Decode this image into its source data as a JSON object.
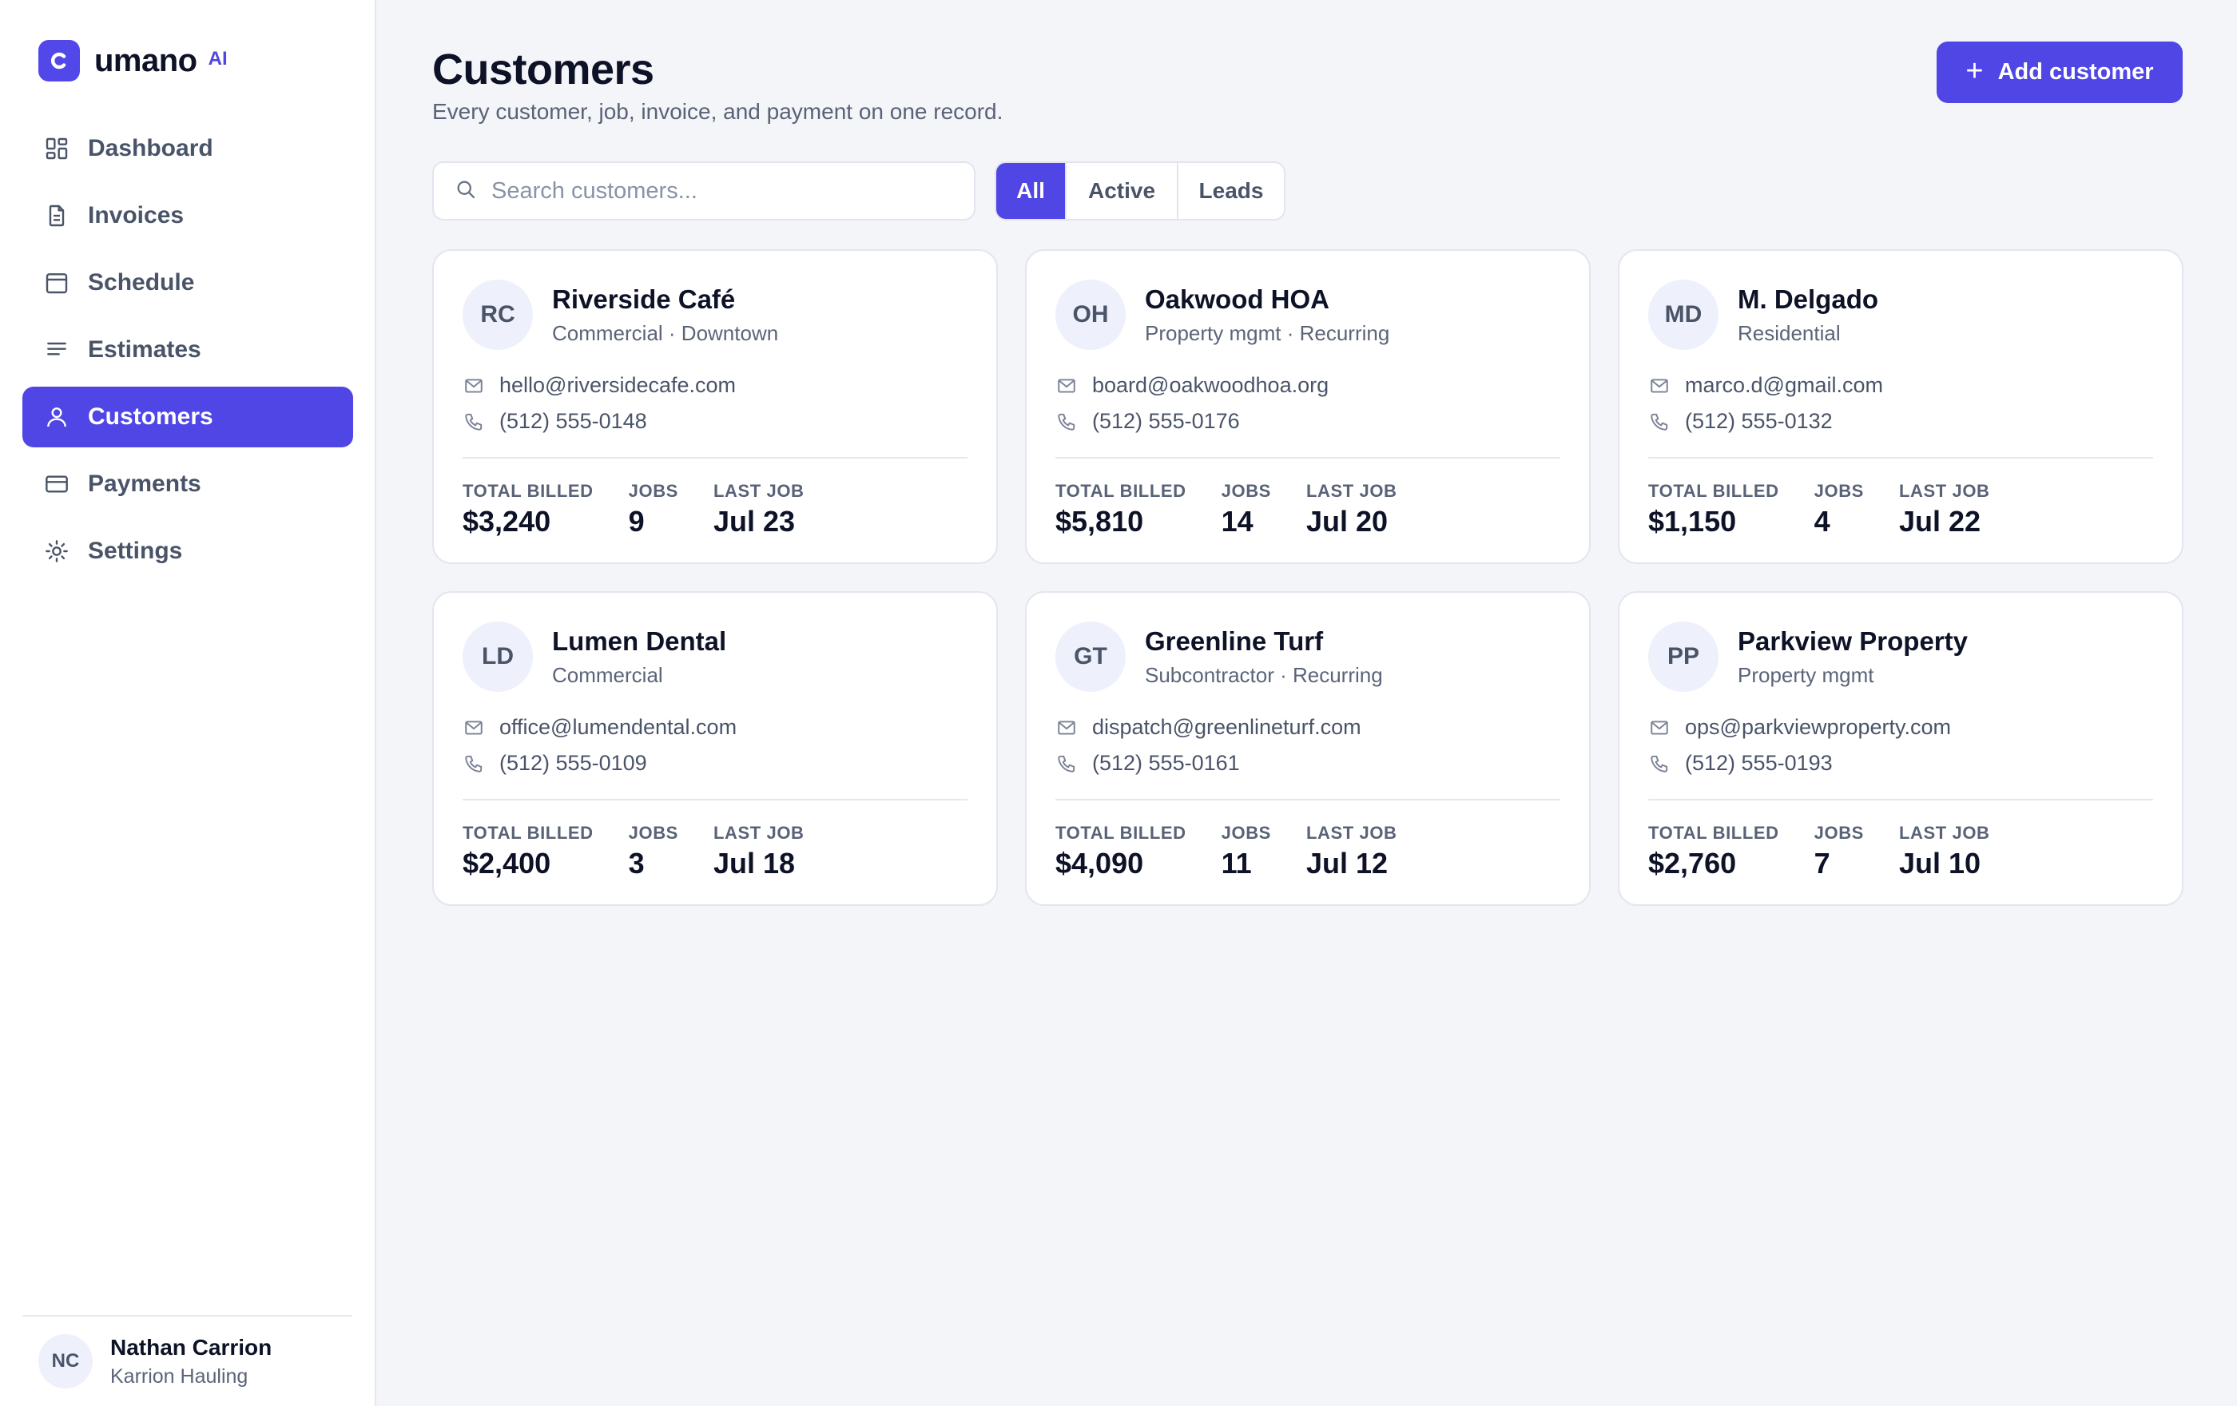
{
  "brand": {
    "name": "umano",
    "tag": "AI",
    "accent": "#4f46e5"
  },
  "nav": {
    "items": [
      {
        "label": "Dashboard",
        "icon": "grid-icon",
        "active": false
      },
      {
        "label": "Invoices",
        "icon": "document-icon",
        "active": false
      },
      {
        "label": "Schedule",
        "icon": "calendar-icon",
        "active": false
      },
      {
        "label": "Estimates",
        "icon": "list-icon",
        "active": false
      },
      {
        "label": "Customers",
        "icon": "user-icon",
        "active": true
      },
      {
        "label": "Payments",
        "icon": "credit-card-icon",
        "active": false
      },
      {
        "label": "Settings",
        "icon": "gear-icon",
        "active": false
      }
    ]
  },
  "user": {
    "initials": "NC",
    "name": "Nathan Carrion",
    "org": "Karrion Hauling"
  },
  "header": {
    "title": "Customers",
    "subtitle": "Every customer, job, invoice, and payment on one record.",
    "add_button": "Add customer"
  },
  "search": {
    "placeholder": "Search customers...",
    "value": ""
  },
  "filters": {
    "tabs": [
      "All",
      "Active",
      "Leads"
    ],
    "selected": "All"
  },
  "stat_labels": {
    "billed": "TOTAL BILLED",
    "jobs": "JOBS",
    "last": "LAST JOB"
  },
  "customers": [
    {
      "initials": "RC",
      "name": "Riverside Café",
      "type": "Commercial · Downtown",
      "email": "hello@riversidecafe.com",
      "phone": "(512) 555-0148",
      "billed": "$3,240",
      "jobs": "9",
      "last_job": "Jul 23"
    },
    {
      "initials": "OH",
      "name": "Oakwood HOA",
      "type": "Property mgmt · Recurring",
      "email": "board@oakwoodhoa.org",
      "phone": "(512) 555-0176",
      "billed": "$5,810",
      "jobs": "14",
      "last_job": "Jul 20"
    },
    {
      "initials": "MD",
      "name": "M. Delgado",
      "type": "Residential",
      "email": "marco.d@gmail.com",
      "phone": "(512) 555-0132",
      "billed": "$1,150",
      "jobs": "4",
      "last_job": "Jul 22"
    },
    {
      "initials": "LD",
      "name": "Lumen Dental",
      "type": "Commercial",
      "email": "office@lumendental.com",
      "phone": "(512) 555-0109",
      "billed": "$2,400",
      "jobs": "3",
      "last_job": "Jul 18"
    },
    {
      "initials": "GT",
      "name": "Greenline Turf",
      "type": "Subcontractor · Recurring",
      "email": "dispatch@greenlineturf.com",
      "phone": "(512) 555-0161",
      "billed": "$4,090",
      "jobs": "11",
      "last_job": "Jul 12"
    },
    {
      "initials": "PP",
      "name": "Parkview Property",
      "type": "Property mgmt",
      "email": "ops@parkviewproperty.com",
      "phone": "(512) 555-0193",
      "billed": "$2,760",
      "jobs": "7",
      "last_job": "Jul 10"
    }
  ]
}
